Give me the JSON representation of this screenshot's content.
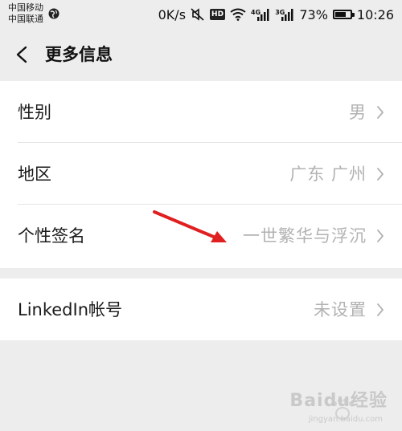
{
  "status_bar": {
    "carrier_1": "中国移动",
    "carrier_2": "中国联通",
    "speed": "0K/s",
    "hd": "HD",
    "net_1": "4G",
    "net_2": "3G",
    "battery_percent": "73%",
    "battery_level": 0.73,
    "time": "10:26"
  },
  "nav": {
    "title": "更多信息"
  },
  "groups": [
    {
      "rows": [
        {
          "label": "性别",
          "value": "男"
        },
        {
          "label": "地区",
          "value": "广东 广州"
        },
        {
          "label": "个性签名",
          "value": "一世繁华与浮沉"
        }
      ]
    },
    {
      "rows": [
        {
          "label": "LinkedIn帐号",
          "value": "未设置"
        }
      ]
    }
  ],
  "watermark": {
    "text": "Baidu经验",
    "sub": "jingyan.baidu.com"
  },
  "colors": {
    "background": "#ededed",
    "row_background": "#ffffff",
    "value_text": "#b2b2b2",
    "annotation_arrow": "#e02020"
  },
  "icons": {
    "back": "chevron-left-icon",
    "row_arrow": "chevron-right-icon",
    "mute": "mute-icon",
    "wifi": "wifi-icon",
    "signal": "signal-icon",
    "battery": "battery-icon",
    "globe": "globe-icon"
  }
}
